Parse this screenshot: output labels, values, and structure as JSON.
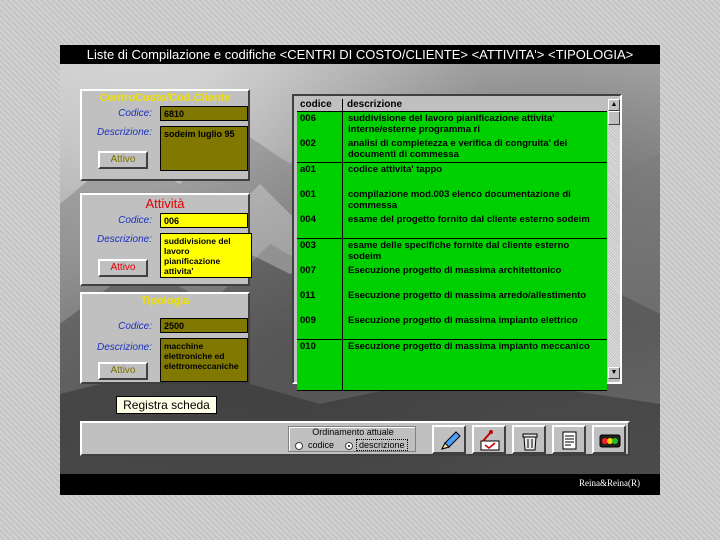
{
  "window": {
    "title": "Liste di Compilazione e codifiche <CENTRI DI COSTO/CLIENTE> <ATTIVITA'> <TIPOLOGIA>"
  },
  "centro": {
    "title": "CentroCosto/Cod.Cliente",
    "codice_label": "Codice:",
    "codice_value": "6810",
    "descrizione_label": "Descrizione:",
    "descrizione_value": "sodeim luglio 95",
    "button_label": "Attivo"
  },
  "attivita": {
    "title": "Attività",
    "codice_label": "Codice:",
    "codice_value": "006",
    "descrizione_label": "Descrizione:",
    "descrizione_value": "suddivisione del lavoro   pianificazione attivita' interne/esterne",
    "button_label": "Attivo"
  },
  "tipologia": {
    "title": "Tipologia",
    "codice_label": "Codice:",
    "codice_value": "2500",
    "descrizione_label": "Descrizione:",
    "descrizione_value": "macchine elettroniche ed elettromeccaniche",
    "button_label": "Attivo"
  },
  "grid": {
    "columns": [
      "codice",
      "descrizione"
    ],
    "rows": [
      {
        "codice": "006",
        "descrizione": " suddivisione del lavoro   pianificazione attivita' interne/esterne programma ri"
      },
      {
        "codice": "002",
        "descrizione": "analisi di completezza e verifica di congruita' dei documenti di commessa"
      },
      {
        "codice": "a01",
        "descrizione": "codice attivita' tappo"
      },
      {
        "codice": "001",
        "descrizione": "compilazione mod.003 elenco documentazione di commessa"
      },
      {
        "codice": "004",
        "descrizione": "esame del progetto fornito dal cliente esterno sodeim"
      },
      {
        "codice": "003",
        "descrizione": "esame delle specifiche fornite dal cliente esterno sodeim"
      },
      {
        "codice": "007",
        "descrizione": "Esecuzione progetto di massima architettonico"
      },
      {
        "codice": "011",
        "descrizione": "Esecuzione progetto di massima arredo/allestimento"
      },
      {
        "codice": "009",
        "descrizione": "Esecuzione progetto di massima impianto elettrico"
      },
      {
        "codice": "010",
        "descrizione": "Esecuzione progetto di massima impianto meccanico"
      },
      {
        "codice": "",
        "descrizione": ""
      }
    ]
  },
  "actions": {
    "registra_label": "Registra scheda"
  },
  "ordinamento": {
    "label": "Ordinamento attuale",
    "option_codice": "codice",
    "option_descrizione": "descrizione",
    "selected": "descrizione"
  },
  "toolbar": {
    "icons": [
      "pencil-icon",
      "paint-icon",
      "trash-icon",
      "document-icon",
      "traffic-light-icon"
    ]
  },
  "footer": {
    "copyright": "Reina&Reina(R)"
  },
  "colors": {
    "grid_green": "#00d000",
    "field_olive": "#807800",
    "field_yellow": "#ffff00",
    "title_yellow": "#f0e000",
    "label_blue": "#1a2fc0",
    "button_red": "#e00000"
  }
}
